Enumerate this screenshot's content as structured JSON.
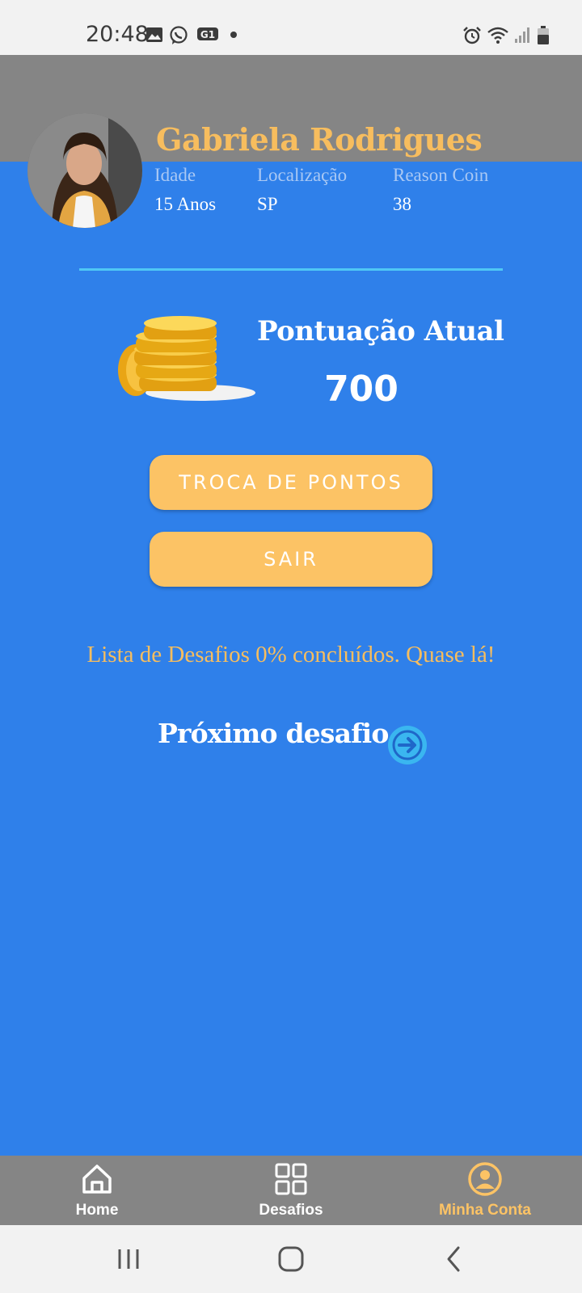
{
  "status_bar": {
    "time": "20:48",
    "left_icons": [
      "image-icon",
      "whatsapp-icon",
      "g1-icon",
      "dot-icon"
    ],
    "right_icons": [
      "alarm-icon",
      "wifi-icon",
      "signal-icon",
      "battery-icon"
    ]
  },
  "profile": {
    "name": "Gabriela Rodrigues",
    "info": [
      {
        "label": "Idade",
        "value": "15 Anos"
      },
      {
        "label": "Localização",
        "value": "SP"
      },
      {
        "label": "Reason Coin",
        "value": "38"
      }
    ]
  },
  "score": {
    "label": "Pontuação Atual",
    "value": "700"
  },
  "buttons": {
    "troca": "TROCA DE PONTOS",
    "sair": "SAIR"
  },
  "progress_text": "Lista de Desafios 0% concluídos. Quase lá!",
  "next_challenge": {
    "label": "Próximo desafio",
    "icon": "arrow-right-circle-icon"
  },
  "bottom_nav": {
    "items": [
      {
        "label": "Home",
        "icon": "home-icon",
        "active": false
      },
      {
        "label": "Desafios",
        "icon": "grid-icon",
        "active": false
      },
      {
        "label": "Minha Conta",
        "icon": "account-icon",
        "active": true
      }
    ]
  },
  "colors": {
    "primary_blue": "#2f80ea",
    "header_grey": "#858585",
    "accent_orange": "#fcc365",
    "name_orange": "#f7bd5e",
    "divider_cyan": "#4fc8f5"
  }
}
